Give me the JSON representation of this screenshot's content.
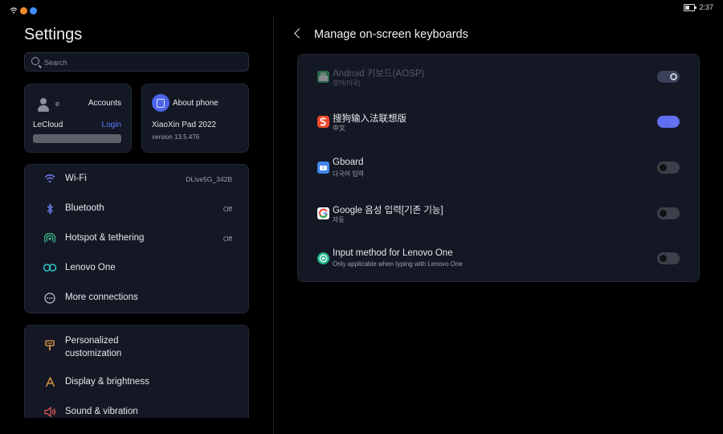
{
  "status_bar": {
    "time": "2:37",
    "left_icons": [
      "wifi-icon",
      "notification-icon-orange",
      "notification-icon-blue"
    ],
    "battery_icon": "battery-icon"
  },
  "left_panel": {
    "title": "Settings",
    "search_placeholder": "Search",
    "account_card": {
      "initial": "e",
      "accounts_label": "Accounts",
      "service": "LeCloud",
      "login_label": "Login"
    },
    "about_card": {
      "title": "About phone",
      "device": "XiaoXin Pad 2022",
      "version": "version 13.5.476"
    },
    "network_items": [
      {
        "label": "Wi-Fi",
        "value": "DLive5G_342B",
        "icon": "wifi-icon"
      },
      {
        "label": "Bluetooth",
        "value": "Off",
        "icon": "bluetooth-icon"
      },
      {
        "label": "Hotspot & tethering",
        "value": "Off",
        "icon": "hotspot-icon"
      },
      {
        "label": "Lenovo One",
        "value": "",
        "icon": "lenovo-one-icon"
      },
      {
        "label": "More connections",
        "value": "",
        "icon": "more-connections-icon"
      }
    ],
    "personal_items": [
      {
        "label": "Personalized customization",
        "icon": "personalize-icon"
      },
      {
        "label": "Display & brightness",
        "icon": "display-icon"
      },
      {
        "label": "Sound & vibration",
        "icon": "sound-icon"
      }
    ]
  },
  "right_panel": {
    "title": "Manage on-screen keyboards",
    "keyboards": [
      {
        "name": "Android 키보드(AOSP)",
        "sub": "영어(미국)",
        "enabled": true,
        "disabled": true,
        "icon": "aosp-keyboard-icon"
      },
      {
        "name": "搜狗输入法联想版",
        "sub": "中文",
        "enabled": true,
        "disabled": false,
        "icon": "sogou-icon"
      },
      {
        "name": "Gboard",
        "sub": "다국어 입력",
        "enabled": false,
        "disabled": false,
        "icon": "gboard-icon"
      },
      {
        "name": "Google 음성 입력[기존 기능]",
        "sub": "자동",
        "enabled": false,
        "disabled": false,
        "icon": "google-voice-icon"
      },
      {
        "name": "Input method for Lenovo One",
        "sub": "Only applicable when typing with Lenovo One",
        "enabled": false,
        "disabled": false,
        "icon": "lenovo-one-input-icon"
      }
    ]
  },
  "colors": {
    "accent": "#5f6ef0",
    "background": "#000000",
    "card": "#141824",
    "login_link": "#5f7bff"
  }
}
